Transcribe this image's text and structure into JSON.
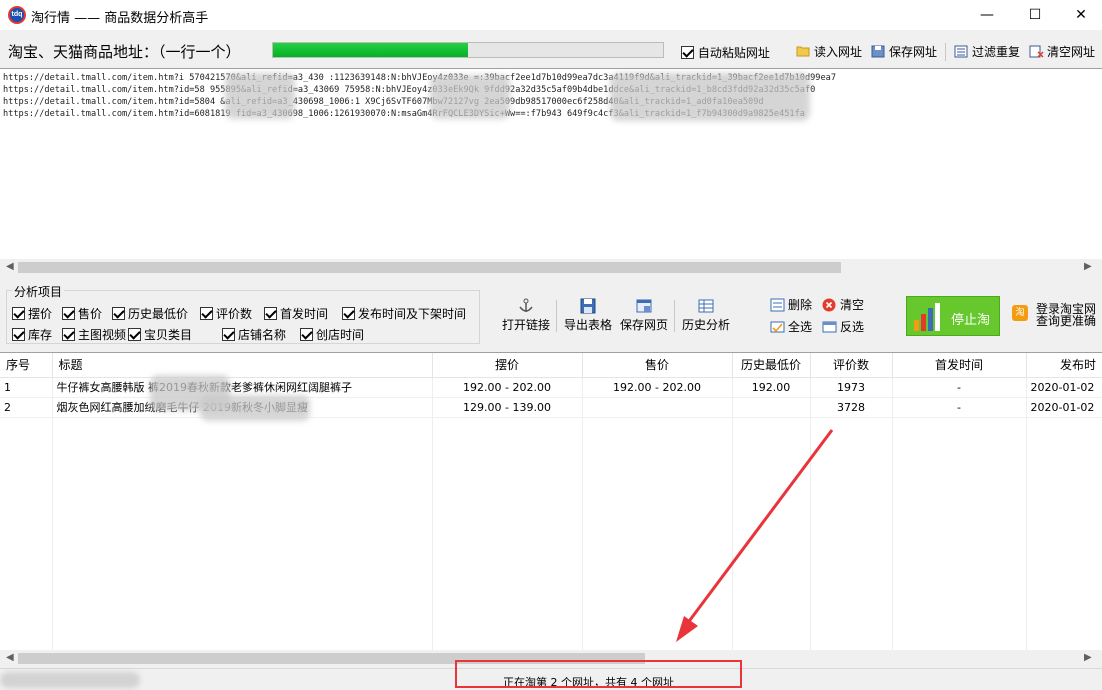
{
  "window": {
    "title": "淘行情 —— 商品数据分析高手",
    "icon_text": "tdq",
    "minimize": "—",
    "maximize": "☐",
    "close": "✕"
  },
  "url_row": {
    "label": "淘宝、天猫商品地址：（一行一个）",
    "progress": 0.5,
    "auto_paste_label": "自动粘贴网址",
    "auto_paste_checked": true,
    "read_button": "读入网址",
    "save_button": "保存网址",
    "filter_button": "过滤重复",
    "clear_button": "清空网址"
  },
  "urls": [
    "https://detail.tmall.com/item.htm?i          570421570&ali_refid=a3_430         :1123639148:N:bhVJEoy4z033e               =:39bacf2ee1d7b10d99ea7dc3a4119f9d&ali_trackid=1_39bacf2ee1d7b10d99ea7",
    "https://detail.tmall.com/item.htm?id=58        955895&ali_refid=a3_43069          75958:N:bhVJEoy4z033eEk9Qk              9fdd92a32d35c5af09b4dbe1ddce&ali_trackid=1_b8cd3fdd92a32d35c5af0",
    "https://detail.tmall.com/item.htm?id=5804          &ali_refid=a3_430698_1006:1          X9Cj6SvTF607Mbw72127vg              2ea509db98517000ec6f258d40&ali_trackid=1_ad0fa10ea509d",
    "https://detail.tmall.com/item.htm?id=6081819          fid=a3_430698_1006:1261930070:N:msaGm4RrFQCLE3DYSic+Ww==:f7b943          649f9c4cf3&ali_trackid=1_f7b94300d9a9825e451fa"
  ],
  "analysis": {
    "group_title": "分析项目",
    "options": [
      {
        "label": "摆价",
        "checked": true
      },
      {
        "label": "售价",
        "checked": true
      },
      {
        "label": "历史最低价",
        "checked": true
      },
      {
        "label": "评价数",
        "checked": true
      },
      {
        "label": "首发时间",
        "checked": true
      },
      {
        "label": "发布时间及下架时间",
        "checked": true
      },
      {
        "label": "库存",
        "checked": true
      },
      {
        "label": "主图视频",
        "checked": true
      },
      {
        "label": "宝贝类目",
        "checked": true
      },
      {
        "label": "店铺名称",
        "checked": true
      },
      {
        "label": "创店时间",
        "checked": true
      }
    ]
  },
  "toolbar": {
    "open_link": "打开链接",
    "export_table": "导出表格",
    "save_page": "保存网页",
    "history": "历史分析",
    "delete": "删除",
    "clear": "清空",
    "select_all": "全选",
    "invert": "反选",
    "stop": "停止淘",
    "login_line1": "登录淘宝网",
    "login_line2": "查询更准确"
  },
  "table": {
    "columns": [
      "序号",
      "标题",
      "摆价",
      "售价",
      "历史最低价",
      "评价数",
      "首发时间",
      "发布时"
    ],
    "rows": [
      [
        "1",
        "牛仔裤女高腰韩版               裤2019春秋新款老爹裤休闲网红阔腿裤子",
        "192.00 - 202.00",
        "192.00 - 202.00",
        "192.00",
        "1973",
        "-",
        "2020-01-02"
      ],
      [
        "2",
        "烟灰色网红高腰加绒磨毛牛仔                   2019新秋冬小脚显瘦",
        "129.00 - 139.00",
        "",
        "",
        "3728",
        "-",
        "2020-01-02"
      ]
    ]
  },
  "status": {
    "text": "正在淘第 2 个网址，共有 4 个网址"
  },
  "colors": {
    "progress": "#06b025",
    "stop_button": "#66c82d",
    "annotation": "#e8343a"
  }
}
